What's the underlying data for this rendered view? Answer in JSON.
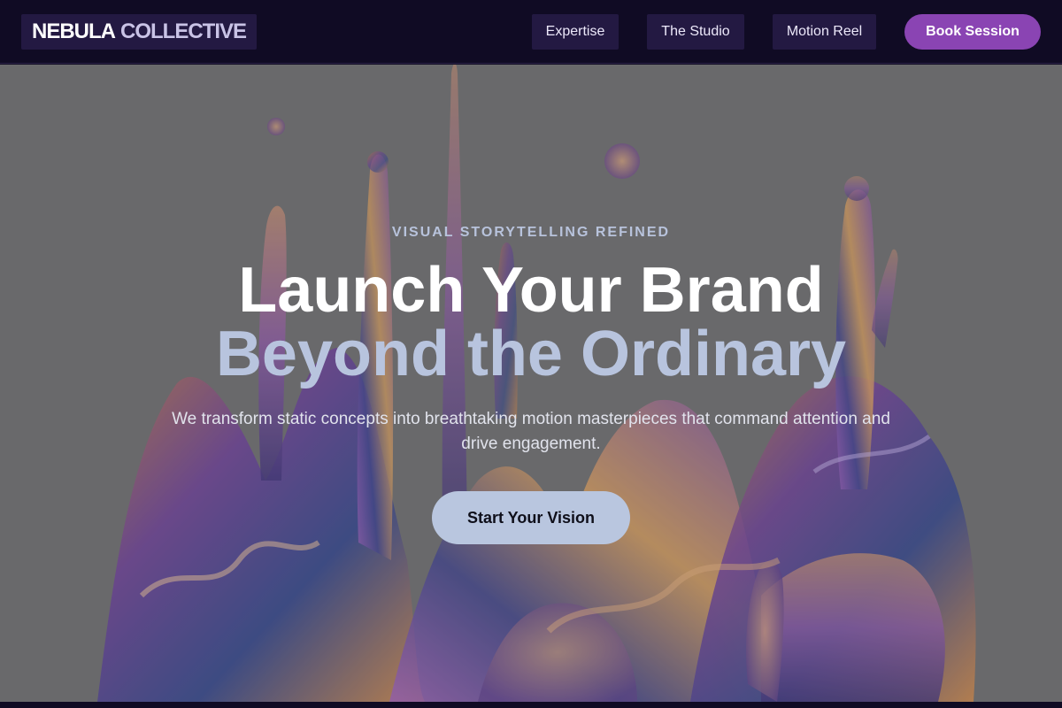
{
  "brand": {
    "part1": "NEBULA",
    "part2": "COLLECTIVE"
  },
  "nav": {
    "links": [
      "Expertise",
      "The Studio",
      "Motion Reel"
    ],
    "cta": "Book Session"
  },
  "hero": {
    "eyebrow": "VISUAL STORYTELLING REFINED",
    "headline_line1": "Launch Your Brand",
    "headline_line2": "Beyond the Ordinary",
    "subtitle": "We transform static concepts into breathtaking motion masterpieces that command attention and drive engagement.",
    "cta": "Start Your Vision",
    "background_icon": "liquid-splash-image"
  },
  "colors": {
    "nav_bg": "#100b24",
    "nav_pill": "#231942",
    "accent": "#8a44b3",
    "headline_accent": "#b8c4de",
    "cta_bg": "#b9c6df"
  }
}
